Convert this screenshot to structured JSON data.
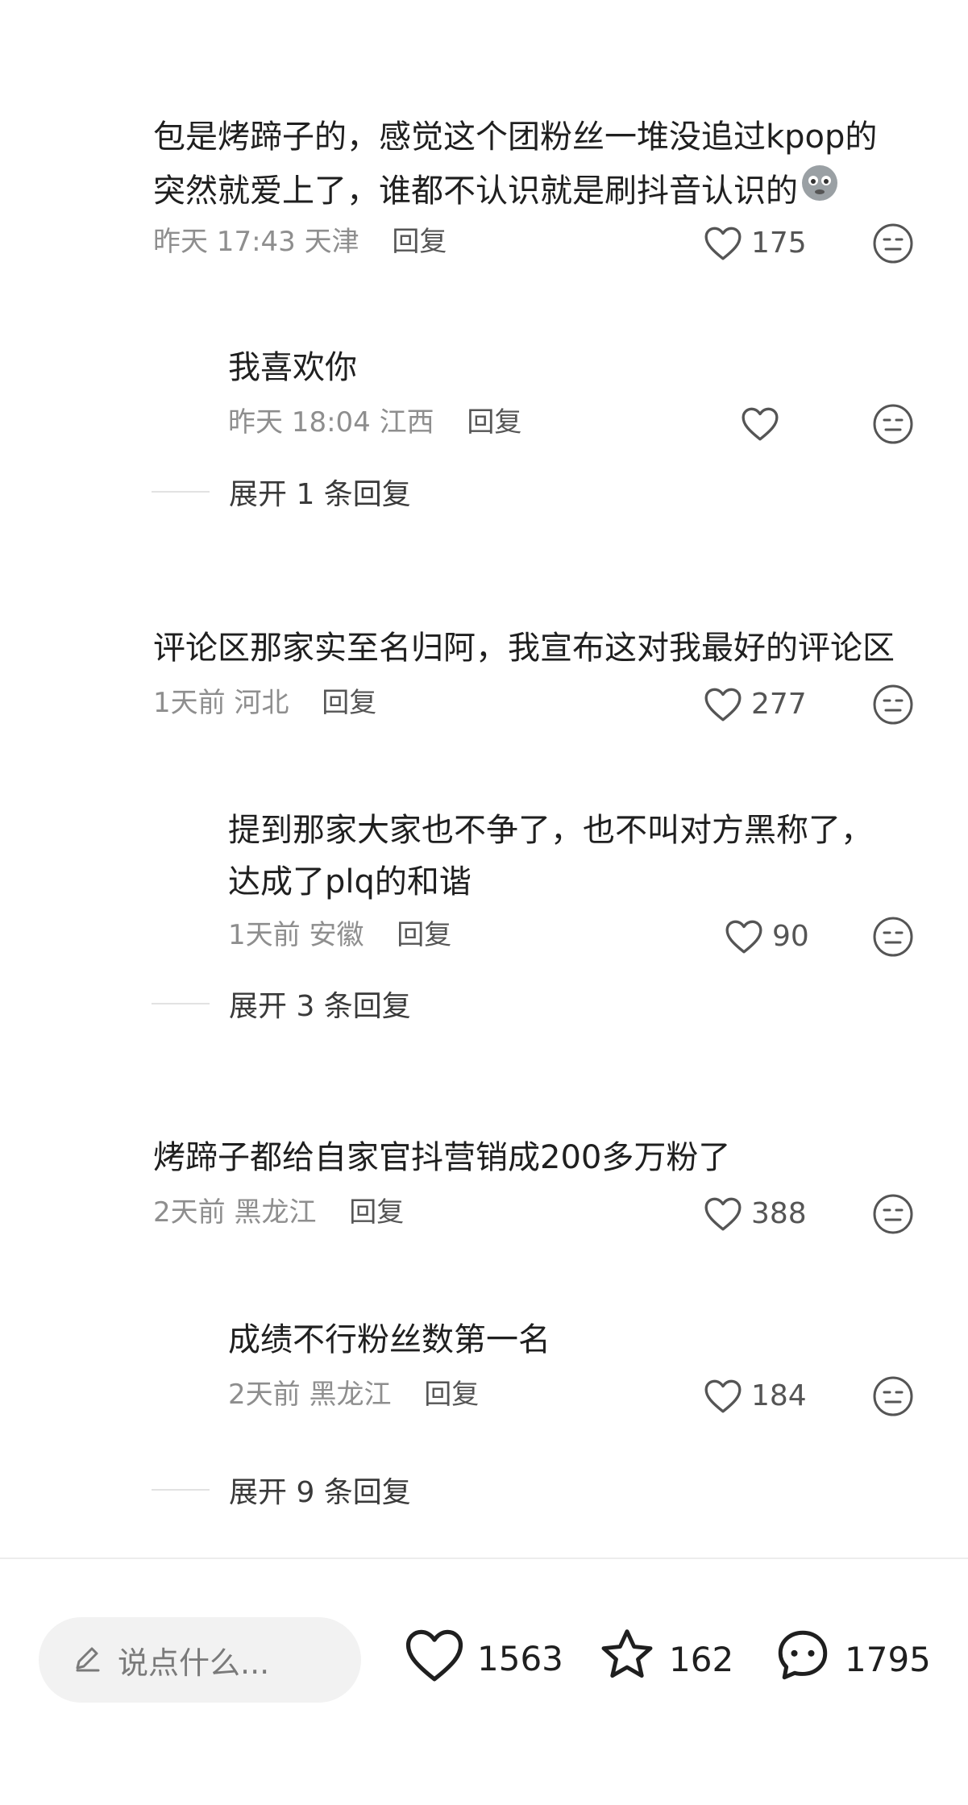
{
  "colors": {
    "text": "#1f1f1f",
    "meta": "#8e8e8e",
    "icon": "#555555",
    "pill": "#f2f2f2"
  },
  "comments": [
    {
      "lines": [
        "包是烤蹄子的，感觉这个团粉丝一堆没追过kpop的",
        "突然就爱上了，谁都不认识就是刷抖音认识的"
      ],
      "emoji_icon": "crying-face-icon",
      "time": "昨天 17:43",
      "location": "天津",
      "reply": "回复",
      "likes": "175"
    },
    {
      "lines": [
        "我喜欢你"
      ],
      "time": "昨天 18:04",
      "location": "江西",
      "reply": "回复",
      "likes": "",
      "expand": "展开 1 条回复"
    },
    {
      "lines": [
        "评论区那家实至名归阿，我宣布这对我最好的评论区"
      ],
      "time": "1天前",
      "location": "河北",
      "reply": "回复",
      "likes": "277"
    },
    {
      "lines": [
        "提到那家大家也不争了，也不叫对方黑称了，",
        "达成了plq的和谐"
      ],
      "time": "1天前",
      "location": "安徽",
      "reply": "回复",
      "likes": "90",
      "expand": "展开 3 条回复"
    },
    {
      "lines": [
        "烤蹄子都给自家官抖营销成200多万粉了"
      ],
      "time": "2天前",
      "location": "黑龙江",
      "reply": "回复",
      "likes": "388"
    },
    {
      "lines": [
        "成绩不行粉丝数第一名"
      ],
      "time": "2天前",
      "location": "黑龙江",
      "reply": "回复",
      "likes": "184",
      "expand": "展开 9 条回复"
    }
  ],
  "bottom_bar": {
    "input_placeholder": "说点什么...",
    "input_icon": "pencil-icon",
    "like_count": "1563",
    "favorite_count": "162",
    "comment_count": "1795"
  }
}
